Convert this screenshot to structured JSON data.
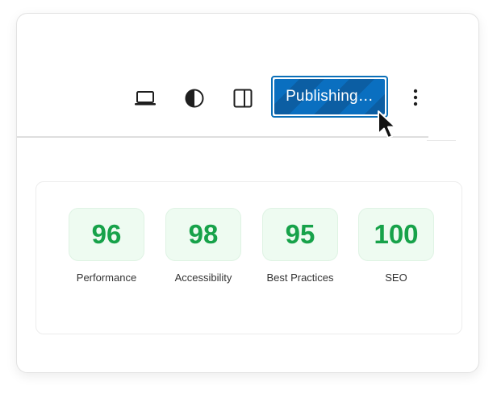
{
  "toolbar": {
    "icons": [
      {
        "name": "laptop-icon",
        "label": "Preview device"
      },
      {
        "name": "contrast-icon",
        "label": "Style toggle"
      },
      {
        "name": "sidebar-icon",
        "label": "Settings sidebar"
      }
    ],
    "publish_label": "Publishing…",
    "publish_color": "#0a6fc0",
    "more_icon": "more-vertical-icon"
  },
  "scores": [
    {
      "value": "96",
      "label": "Performance"
    },
    {
      "value": "98",
      "label": "Accessibility"
    },
    {
      "value": "95",
      "label": "Best Practices"
    },
    {
      "value": "100",
      "label": "SEO"
    }
  ],
  "colors": {
    "score_text": "#17a24a",
    "score_bg": "#eefbf1"
  }
}
